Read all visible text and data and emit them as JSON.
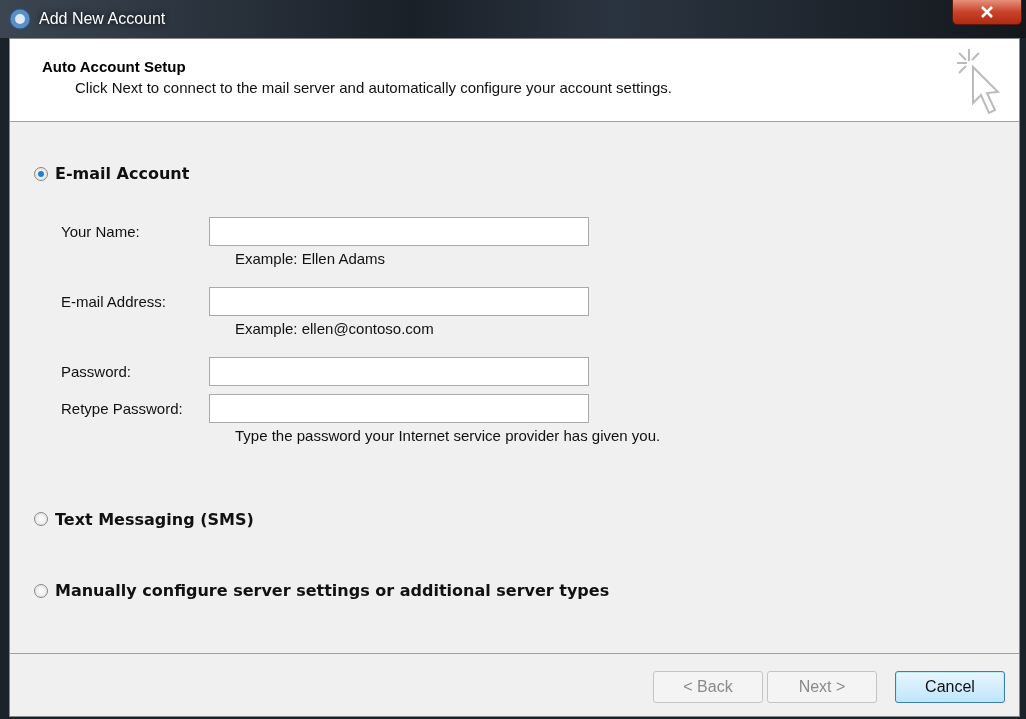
{
  "window": {
    "title": "Add New Account"
  },
  "header": {
    "title": "Auto Account Setup",
    "subtitle": "Click Next to connect to the mail server and automatically configure your account settings."
  },
  "options": [
    {
      "label": "E-mail Account",
      "selected": true,
      "fields": [
        {
          "label": "Your Name:",
          "hint": "Example: Ellen Adams"
        },
        {
          "label": "E-mail Address:",
          "hint": "Example: ellen@contoso.com"
        },
        {
          "label": "Password:"
        },
        {
          "label": "Retype Password:",
          "hint": "Type the password your Internet service provider has given you."
        }
      ]
    },
    {
      "label": "Text Messaging (SMS)",
      "selected": false
    },
    {
      "label": "Manually configure server settings or additional server types",
      "selected": false
    }
  ],
  "buttons": [
    {
      "label": "< Back",
      "disabled": true,
      "default": false
    },
    {
      "label": "Next >",
      "disabled": true,
      "default": false
    },
    {
      "label": "Cancel",
      "disabled": false,
      "default": true
    }
  ]
}
